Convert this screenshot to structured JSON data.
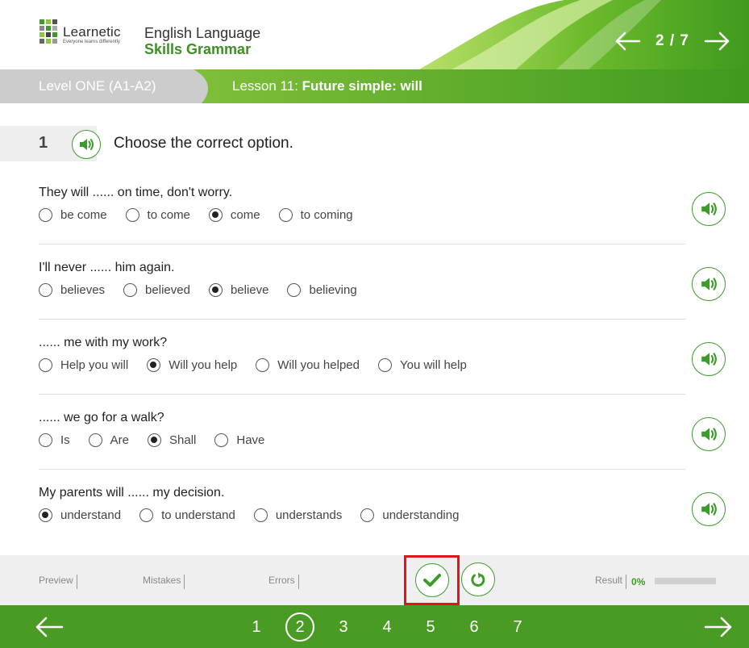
{
  "header": {
    "logo_text": "Learnetic",
    "logo_tagline": "Everyone learns differently",
    "course_line1": "English Language",
    "course_line2": "Skills Grammar",
    "page_indicator": "2 / 7"
  },
  "level_bar": {
    "level": "Level ONE (A1-A2)",
    "lesson_prefix": "Lesson 11:",
    "lesson_title": "Future simple: will"
  },
  "exercise": {
    "number": "1",
    "instruction": "Choose the correct option."
  },
  "questions": [
    {
      "prompt": "They will ...... on time, don't worry.",
      "options": [
        "be come",
        "to come",
        "come",
        "to coming"
      ],
      "selected": 2
    },
    {
      "prompt": "I'll never ...... him again.",
      "options": [
        "believes",
        "believed",
        "believe",
        "believing"
      ],
      "selected": 2
    },
    {
      "prompt": "...... me with my work?",
      "options": [
        "Help you will",
        "Will you help",
        "Will you helped",
        "You will help"
      ],
      "selected": 1
    },
    {
      "prompt": "...... we go for a walk?",
      "options": [
        "Is",
        "Are",
        "Shall",
        "Have"
      ],
      "selected": 2
    },
    {
      "prompt": "My parents will ...... my decision.",
      "options": [
        "understand",
        "to understand",
        "understands",
        "understanding"
      ],
      "selected": 0
    }
  ],
  "toolbar": {
    "preview": "Preview",
    "mistakes": "Mistakes",
    "errors": "Errors",
    "result_label": "Result",
    "result_value": "0%",
    "result_progress": 0
  },
  "footer": {
    "pages": [
      "1",
      "2",
      "3",
      "4",
      "5",
      "6",
      "7"
    ],
    "current_page": 1
  },
  "colors": {
    "brand_green": "#4a9b24",
    "accent_green": "#3d9b2a",
    "highlight_red": "#e01616"
  }
}
